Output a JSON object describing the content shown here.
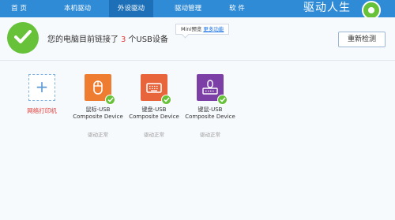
{
  "nav": {
    "tabs": [
      {
        "label": "首 页"
      },
      {
        "label": "本机驱动"
      },
      {
        "label": "外设驱动"
      },
      {
        "label": "驱动管理"
      },
      {
        "label": "软 件"
      }
    ],
    "active_tab": "外设驱动",
    "brand": "驱动人生"
  },
  "status": {
    "prefix": "您的电脑目前链接了",
    "count": "3",
    "suffix": "个USB设备"
  },
  "tooltip": {
    "text": "Mini预览",
    "link": "更多功能"
  },
  "rescan_button": "重新检测",
  "add_printer_label": "网络打印机",
  "devices": [
    {
      "name_line1": "鼠标-USB",
      "name_line2": "Composite Device",
      "status": "驱动正常"
    },
    {
      "name_line1": "键盘-USB",
      "name_line2": "Composite Device",
      "status": "驱动正常"
    },
    {
      "name_line1": "键鼠-USB",
      "name_line2": "Composite Device",
      "status": "驱动正常"
    }
  ],
  "colors": {
    "nav_bg": "#2f8bd6",
    "active_tab": "#1d70b8",
    "ok_green": "#67c23a",
    "count_red": "#e53935",
    "mouse_icon": "#ef7d31",
    "keyboard_icon": "#e8643a",
    "combo_icon": "#7b3fa6"
  },
  "icons": [
    "check-icon",
    "plus-icon",
    "mouse-icon",
    "keyboard-icon",
    "keyboard-mouse-icon",
    "logo-icon"
  ]
}
